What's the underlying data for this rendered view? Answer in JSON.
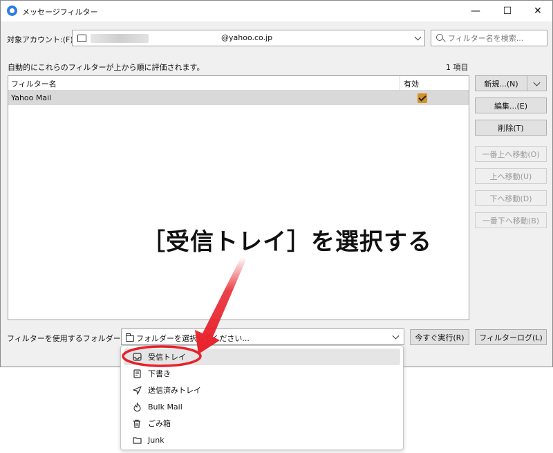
{
  "window": {
    "title": "メッセージフィルター",
    "controls": {
      "minimize": "—",
      "maximize": "☐",
      "close": "✕"
    }
  },
  "account": {
    "label": "対象アカウント:(F)",
    "value": "@yahoo.co.jp"
  },
  "search": {
    "placeholder": "フィルター名を検索..."
  },
  "filters": {
    "description": "自動的にこれらのフィルターが上から順に評価されます。",
    "count": "1 項目",
    "columns": {
      "name": "フィルター名",
      "enabled": "有効"
    },
    "rows": [
      {
        "name": "Yahoo Mail",
        "enabled": true
      }
    ]
  },
  "buttons": {
    "new": "新規...(N)",
    "edit": "編集...(E)",
    "delete": "削除(T)",
    "move_top": "一番上へ移動(O)",
    "move_up": "上へ移動(U)",
    "move_down": "下へ移動(D)",
    "move_bottom": "一番下へ移動(B)",
    "run_now": "今すぐ実行(R)",
    "filter_log": "フィルターログ(L)"
  },
  "folder": {
    "label": "フィルターを使用するフォルダー:(C)",
    "placeholder": "フォルダーを選択してください..."
  },
  "dropdown": {
    "items": [
      {
        "label": "受信トレイ",
        "icon": "inbox-icon"
      },
      {
        "label": "下書き",
        "icon": "draft-icon"
      },
      {
        "label": "送信済みトレイ",
        "icon": "send-icon"
      },
      {
        "label": "Bulk Mail",
        "icon": "flame-icon"
      },
      {
        "label": "ごみ箱",
        "icon": "trash-icon"
      },
      {
        "label": "Junk",
        "icon": "folder-icon"
      }
    ]
  },
  "annotation": {
    "text": "［受信トレイ］を選択する",
    "color": "#e8202a"
  }
}
